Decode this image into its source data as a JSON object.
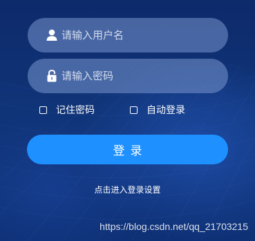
{
  "form": {
    "username_placeholder": "请输入用户名",
    "username_value": "",
    "password_placeholder": "请输入密码",
    "password_value": "",
    "remember_label": "记住密码",
    "remember_checked": false,
    "auto_login_label": "自动登录",
    "auto_login_checked": false,
    "login_label": "登录",
    "settings_link": "点击进入登录设置"
  },
  "icons": {
    "username": "user-icon",
    "password": "lock-icon"
  },
  "colors": {
    "background": "#0f3274",
    "field": "#7896cd",
    "button": "#1e90ff",
    "text": "#ffffff"
  },
  "watermark": "https://blog.csdn.net/qq_21703215"
}
